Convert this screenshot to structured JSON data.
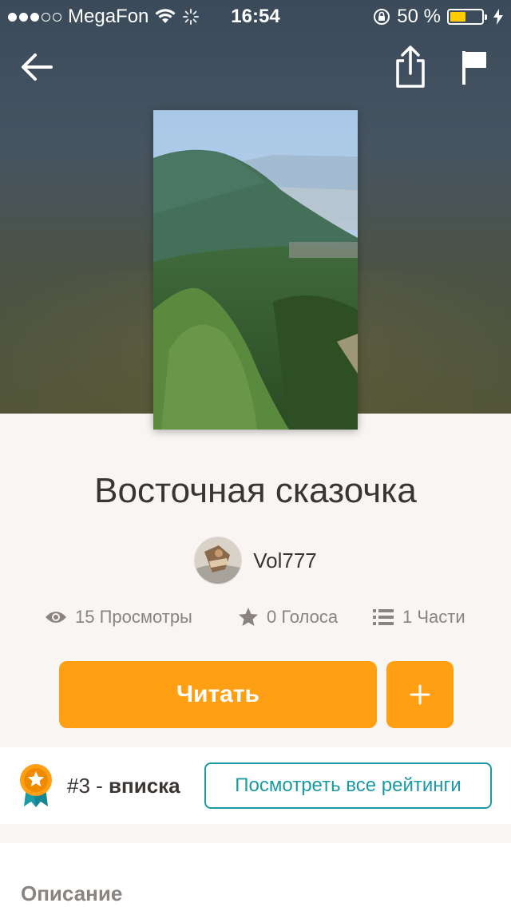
{
  "status_bar": {
    "carrier": "MegaFon",
    "time": "16:54",
    "battery_percent": "50 %",
    "battery_level": 0.5,
    "signal_filled": 3,
    "signal_total": 5
  },
  "header": {
    "back_icon": "arrow-left-icon",
    "share_icon": "share-icon",
    "flag_icon": "flag-icon"
  },
  "story": {
    "title": "Восточная сказочка",
    "author": "Vol777",
    "stats": {
      "views": "15 Просмотры",
      "votes": "0 Голоса",
      "parts": "1 Части"
    },
    "read_label": "Читать",
    "add_label": "+"
  },
  "ranking": {
    "number": "#3",
    "separator": " - ",
    "tag": "вписка",
    "view_all_label": "Посмотреть все рейтинги"
  },
  "description": {
    "heading": "Описание"
  },
  "colors": {
    "accent": "#ff9f14",
    "link": "#1b9aa5"
  }
}
